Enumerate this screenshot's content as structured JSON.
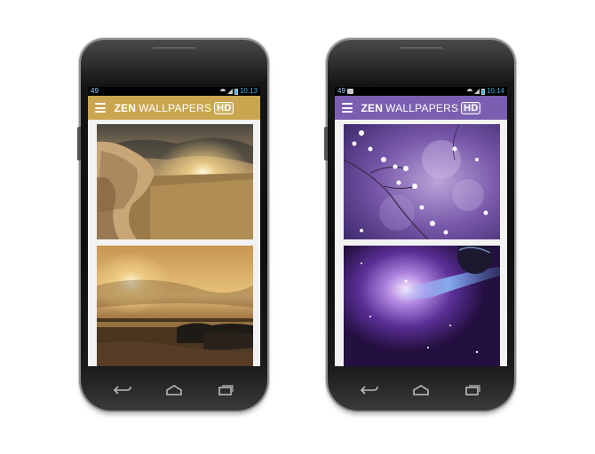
{
  "phones": [
    {
      "status": {
        "left_text": "49",
        "time": "10:13"
      },
      "appbar": {
        "title_bold": "ZEN",
        "title_rest": "WALLPAPERS",
        "badge": "HD",
        "color": "#c9a64f"
      },
      "wallpapers": [
        "rocky-sunset",
        "ocean-sunset"
      ]
    },
    {
      "status": {
        "left_text": "49",
        "time": "10:14"
      },
      "appbar": {
        "title_bold": "ZEN",
        "title_rest": "WALLPAPERS",
        "badge": "HD",
        "color": "#7a5fb0"
      },
      "wallpapers": [
        "purple-blossoms",
        "purple-galaxy"
      ]
    }
  ],
  "navbar_icons": [
    "back-icon",
    "home-icon",
    "recent-apps-icon"
  ]
}
